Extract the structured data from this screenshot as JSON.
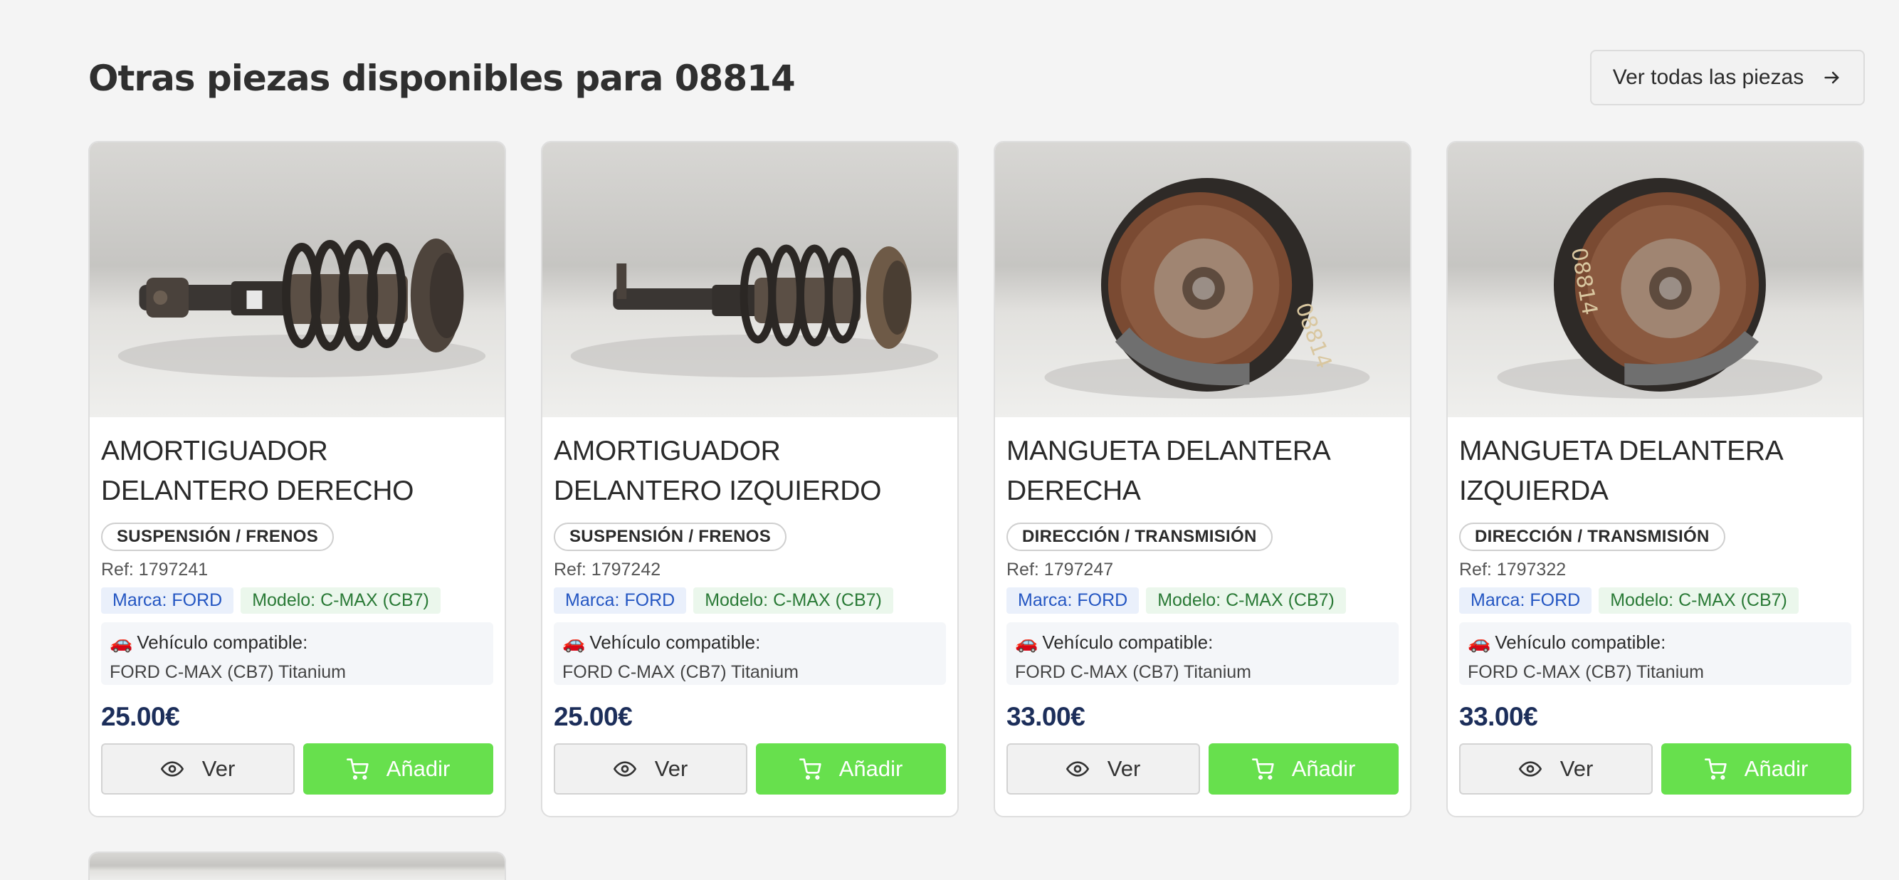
{
  "section": {
    "title": "Otras piezas disponibles para 08814",
    "view_all_label": "Ver todas las piezas"
  },
  "colors": {
    "add_button": "#67e04d",
    "price": "#1c2e5a",
    "brand_tag_text": "#2456c2",
    "model_tag_text": "#2a7a36"
  },
  "cards": [
    {
      "name": "AMORTIGUADOR DELANTERO DERECHO",
      "category": "SUSPENSIÓN / FRENOS",
      "ref": "Ref: 1797241",
      "brand": "Marca: FORD",
      "model": "Modelo: C-MAX (CB7)",
      "compat_label": "Vehículo compatible:",
      "compat_icon": "🚗",
      "compat_value": "FORD C-MAX (CB7) Titanium",
      "price": "25.00€",
      "view_label": "Ver",
      "add_label": "Añadir",
      "image": "shock-absorber"
    },
    {
      "name": "AMORTIGUADOR DELANTERO IZQUIERDO",
      "category": "SUSPENSIÓN / FRENOS",
      "ref": "Ref: 1797242",
      "brand": "Marca: FORD",
      "model": "Modelo: C-MAX (CB7)",
      "compat_label": "Vehículo compatible:",
      "compat_icon": "🚗",
      "compat_value": "FORD C-MAX (CB7) Titanium",
      "price": "25.00€",
      "view_label": "Ver",
      "add_label": "Añadir",
      "image": "shock-absorber"
    },
    {
      "name": "MANGUETA DELANTERA DERECHA",
      "category": "DIRECCIÓN / TRANSMISIÓN",
      "ref": "Ref: 1797247",
      "brand": "Marca: FORD",
      "model": "Modelo: C-MAX (CB7)",
      "compat_label": "Vehículo compatible:",
      "compat_icon": "🚗",
      "compat_value": "FORD C-MAX (CB7) Titanium",
      "price": "33.00€",
      "view_label": "Ver",
      "add_label": "Añadir",
      "image": "steering-knuckle"
    },
    {
      "name": "MANGUETA DELANTERA IZQUIERDA",
      "category": "DIRECCIÓN / TRANSMISIÓN",
      "ref": "Ref: 1797322",
      "brand": "Marca: FORD",
      "model": "Modelo: C-MAX (CB7)",
      "compat_label": "Vehículo compatible:",
      "compat_icon": "🚗",
      "compat_value": "FORD C-MAX (CB7) Titanium",
      "price": "33.00€",
      "view_label": "Ver",
      "add_label": "Añadir",
      "image": "steering-knuckle"
    }
  ]
}
